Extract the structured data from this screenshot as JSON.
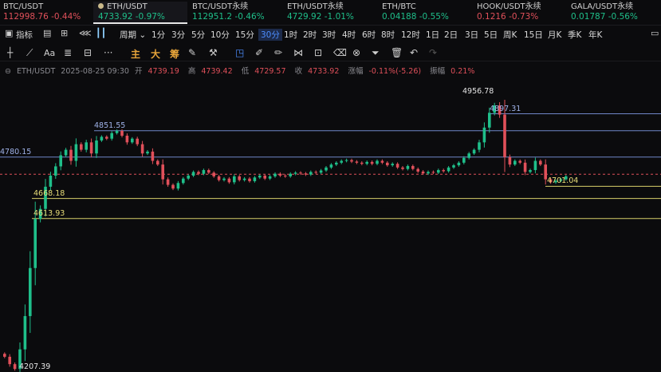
{
  "tickers": [
    {
      "name": "BTC/USDT",
      "price": "112998.76",
      "change": "-0.44%",
      "dir": "down",
      "active": false
    },
    {
      "name": "ETH/USDT",
      "price": "4733.92",
      "change": "-0.97%",
      "dir": "up",
      "active": true
    },
    {
      "name": "BTC/USDT永续",
      "price": "112951.2",
      "change": "-0.46%",
      "dir": "up",
      "active": false
    },
    {
      "name": "ETH/USDT永续",
      "price": "4729.92",
      "change": "-1.01%",
      "dir": "up",
      "active": false
    },
    {
      "name": "ETH/BTC",
      "price": "0.04188",
      "change": "-0.55%",
      "dir": "up",
      "active": false
    },
    {
      "name": "HOOK/USDT永续",
      "price": "0.1216",
      "change": "-0.73%",
      "dir": "down",
      "active": false
    },
    {
      "name": "GALA/USDT永续",
      "price": "0.01787",
      "change": "-0.56%",
      "dir": "up",
      "active": false
    }
  ],
  "intervals": {
    "indicator_label": "指标",
    "period_label": "周期",
    "items": [
      "1分",
      "3分",
      "5分",
      "10分",
      "15分",
      "30分",
      "1时",
      "2时",
      "3时",
      "4时",
      "6时",
      "8时",
      "12时",
      "1日",
      "2日",
      "3日",
      "5日",
      "周K",
      "15日",
      "月K",
      "季K",
      "年K"
    ],
    "selected": "30分"
  },
  "drawtools": {
    "font_tool": "Aa",
    "more": "···",
    "cn_tools": [
      "主",
      "大",
      "筹"
    ]
  },
  "info": {
    "symbol": "ETH/USDT",
    "datetime": "2025-08-25 09:30",
    "open_label": "开",
    "open": "4739.19",
    "high_label": "高",
    "high": "4739.42",
    "low_label": "低",
    "low": "4729.57",
    "close_label": "收",
    "close": "4733.92",
    "change_label": "涨幅",
    "change": "-0.11%(-5.26)",
    "amp_label": "振幅",
    "amp": "0.21%"
  },
  "price_labels": {
    "high_mark": "4956.78",
    "line_4897": "4897.31",
    "line_4851": "4851.55",
    "line_4780": "4780.15",
    "line_4701": "4701.04",
    "line_4668": "4668.18",
    "line_4613": "4613.93",
    "low_mark": "4207.39"
  },
  "colors": {
    "up": "#1fbf8a",
    "down": "#e0505a",
    "blue_line": "#6f86c8",
    "yellow_line": "#d8cf6a",
    "selected": "#4d8dff"
  },
  "chart_data": {
    "type": "candlestick",
    "y_unit": "USDT",
    "ylim": [
      4207.39,
      4956.78
    ],
    "horizontal_levels": [
      4897.31,
      4851.55,
      4780.15,
      4733.92,
      4701.04,
      4668.18,
      4613.93
    ],
    "current_price_level": 4733.92,
    "closes": [
      4240,
      4220,
      4207,
      4260,
      4350,
      4480,
      4613,
      4640,
      4700,
      4730,
      4755,
      4785,
      4800,
      4770,
      4815,
      4800,
      4820,
      4790,
      4825,
      4835,
      4830,
      4845,
      4851,
      4838,
      4820,
      4830,
      4815,
      4790,
      4795,
      4770,
      4760,
      4720,
      4705,
      4695,
      4710,
      4722,
      4730,
      4740,
      4735,
      4745,
      4738,
      4728,
      4718,
      4722,
      4712,
      4728,
      4718,
      4722,
      4715,
      4725,
      4730,
      4722,
      4728,
      4735,
      4730,
      4728,
      4735,
      4738,
      4736,
      4733,
      4740,
      4738,
      4744,
      4752,
      4760,
      4765,
      4770,
      4772,
      4768,
      4765,
      4762,
      4767,
      4762,
      4770,
      4765,
      4758,
      4762,
      4752,
      4748,
      4756,
      4748,
      4741,
      4736,
      4740,
      4738,
      4745,
      4742,
      4752,
      4758,
      4765,
      4778,
      4790,
      4800,
      4820,
      4860,
      4900,
      4920,
      4895,
      4780,
      4760,
      4770,
      4765,
      4740,
      4745,
      4770,
      4760,
      4720,
      4712,
      4716,
      4720,
      4728
    ]
  }
}
